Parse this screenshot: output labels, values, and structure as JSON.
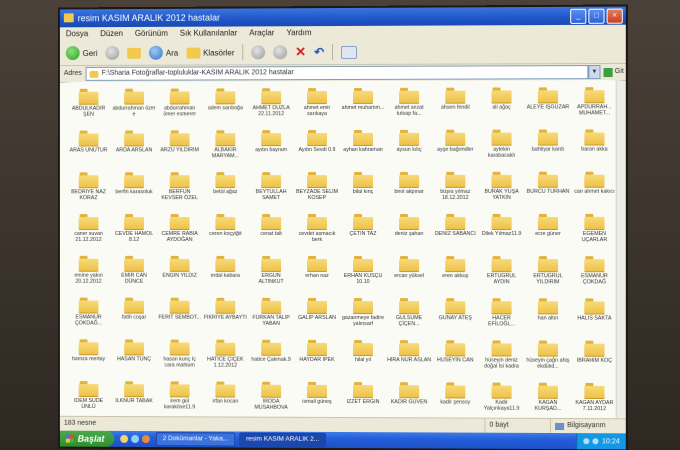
{
  "window": {
    "title": "resim KASIM ARALIK 2012 hastalar",
    "controls": [
      "_",
      "□",
      "×"
    ]
  },
  "menu": [
    "Dosya",
    "Düzen",
    "Görünüm",
    "Sık Kullanılanlar",
    "Araçlar",
    "Yardım"
  ],
  "toolbar": {
    "back": "Geri",
    "search": "Ara",
    "folders": "Klasörler"
  },
  "address": {
    "label": "Adres",
    "path": "F:\\Sharia Fotoğraflar-topluluklar-KASIM ARALIK 2012 hastalar",
    "go": "Git"
  },
  "folders": [
    "ABDULKADİR ŞEN",
    "abdurrahman özer e",
    "abdurrahman ömer esmerer",
    "adem sarıboğa",
    "AHMET DUZLA 22.11.2012",
    "ahmet emir sarıkaya",
    "ahmet muhamm...",
    "ahmet sezat tutsap fa...",
    "ahsen fendil",
    "ali ağaç",
    "ALEYE İŞGÜZAR",
    "APDURRAH... MUHAMET...",
    "ARAS UNUTUR",
    "ARDA ARSLAN",
    "ARZU YILDIRIM",
    "ALBAKIR MARYAM...",
    "aydın bayram",
    "Aydın Sevdi 0.9",
    "ayhan kahraman",
    "aysun kılıç",
    "ayşe bağımdler",
    "aytekin karabacaklı",
    "bahtiyar kardı",
    "baran akka",
    "BEDRİYE NAZ KORAZ",
    "berfin karasoluk",
    "BERFUN KEVSER ÖZEL",
    "betül ağaz",
    "BEYTULLAH SAMET",
    "BEYZADE SELİM KOSEP",
    "bilal kınç",
    "birol akpınar",
    "büşra yılmaz 18.12.2012",
    "BURAK YUŞA YATKIN",
    "BURCU TURHAN",
    "can ahmet kakıcı",
    "caner suvan 21.12.2012",
    "CEVDE HAMOL 8.12",
    "CEMRE RABİA AYDOĞAN",
    "ceren koçyiğit",
    "cenat talt",
    "cevdet asmacık berk",
    "ÇETİN TAZ",
    "deniz şahan",
    "DENİZ SABANCI",
    "Dilek Yılmaz11.9",
    "ecre güner",
    "EGEMEN UÇARLAR",
    "emine yakın 20.12.2012",
    "EMİR CAN DÜNCE",
    "ENGİN YILDIZ",
    "erdal kabara",
    "ERGUN ALTINKUT",
    "erhan naz",
    "ERHAN KUSÇU 10.10",
    "ercan yüksel",
    "eren akkuş",
    "ERTUĞRUL AYDIN",
    "ERTUĞRUL YILDIRIM",
    "ESMANUR ÇOKDAĞ",
    "ESMANUR ÇOKDAĞ...",
    "fatih coşar",
    "FERİT SEMBOT...",
    "FIKRİYE AYBAYTI",
    "FURKAN TALİP YABAN",
    "GALİP ARSLAN",
    "gazanmeye fadire yalınsarf",
    "GÜLSÜME ÇİÇEN...",
    "GÜNAY ATEŞ",
    "HACER EFİLOĞL...",
    "han altın",
    "HALİS SAKTA",
    "hamza mertay",
    "HASAN TUNÇ",
    "hasan kunç İç cara mahlum",
    "HATİCE ÇİÇEK 1.12.2012",
    "hatice Çakmak.9",
    "HAYDAR İPEK",
    "hilal yıl",
    "HİRA NUR ASLAN",
    "HÜSEYİN CAN",
    "hüseyin deniz doğal İsi kadra",
    "hüseyin çağrı ahiş ekdülıd...",
    "İBRAHİM KOÇ",
    "İDEM SUDE ÜNLÜ",
    "İLKNUR TABAK",
    "irem gül karaköse11.9",
    "irfan kocan",
    "İRODA MUSAHBOVA",
    "ismail güneş",
    "İZZET ERGİN",
    "KADİR GÜVEN",
    "kadir şensoy",
    "Kadir Yalçınkaya11.9",
    "KAĞAN KURŞAD...",
    "KAĞAN AYDAR 7.11.2012",
    "kenan uçar",
    "m. arda erol",
    "Mehdi BAŞARAN",
    "mehmet ekren",
    "MEHMET AKYILDIZ",
    "MEHMET AYKAL",
    "Mehmet Eğmir.9",
    "mehmet yağcığlu"
  ],
  "status": {
    "objects": "183 nesne",
    "size": "0 bayt",
    "location": "Bilgisayarım"
  },
  "taskbar": {
    "start": "Başlat",
    "tasks": [
      "2 Dokümanlar - Yaka...",
      "resim KASIM ARALIK 2..."
    ],
    "clock": "10:24"
  }
}
